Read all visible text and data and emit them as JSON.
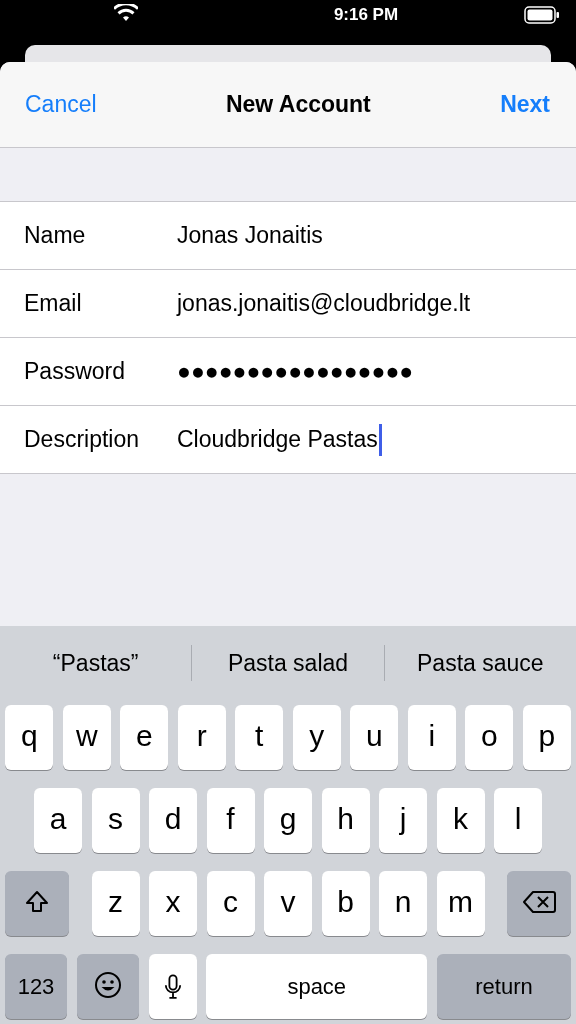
{
  "status_bar": {
    "time": "9:16 PM"
  },
  "nav": {
    "cancel": "Cancel",
    "title": "New Account",
    "next": "Next"
  },
  "fields": [
    {
      "label": "Name",
      "value": "Jonas Jonaitis",
      "focused": false
    },
    {
      "label": "Email",
      "value": "jonas.jonaitis@cloudbridge.lt",
      "focused": false
    },
    {
      "label": "Password",
      "value": "●●●●●●●●●●●●●●●●●",
      "focused": false
    },
    {
      "label": "Description",
      "value": "Cloudbridge Pastas",
      "focused": true
    }
  ],
  "suggestions": [
    "“Pastas”",
    "Pasta salad",
    "Pasta sauce"
  ],
  "keyboard": {
    "rows": [
      [
        "q",
        "w",
        "e",
        "r",
        "t",
        "y",
        "u",
        "i",
        "o",
        "p"
      ],
      [
        "a",
        "s",
        "d",
        "f",
        "g",
        "h",
        "j",
        "k",
        "l"
      ],
      [
        "z",
        "x",
        "c",
        "v",
        "b",
        "n",
        "m"
      ]
    ],
    "mode_key": "123",
    "space": "space",
    "return": "return"
  }
}
